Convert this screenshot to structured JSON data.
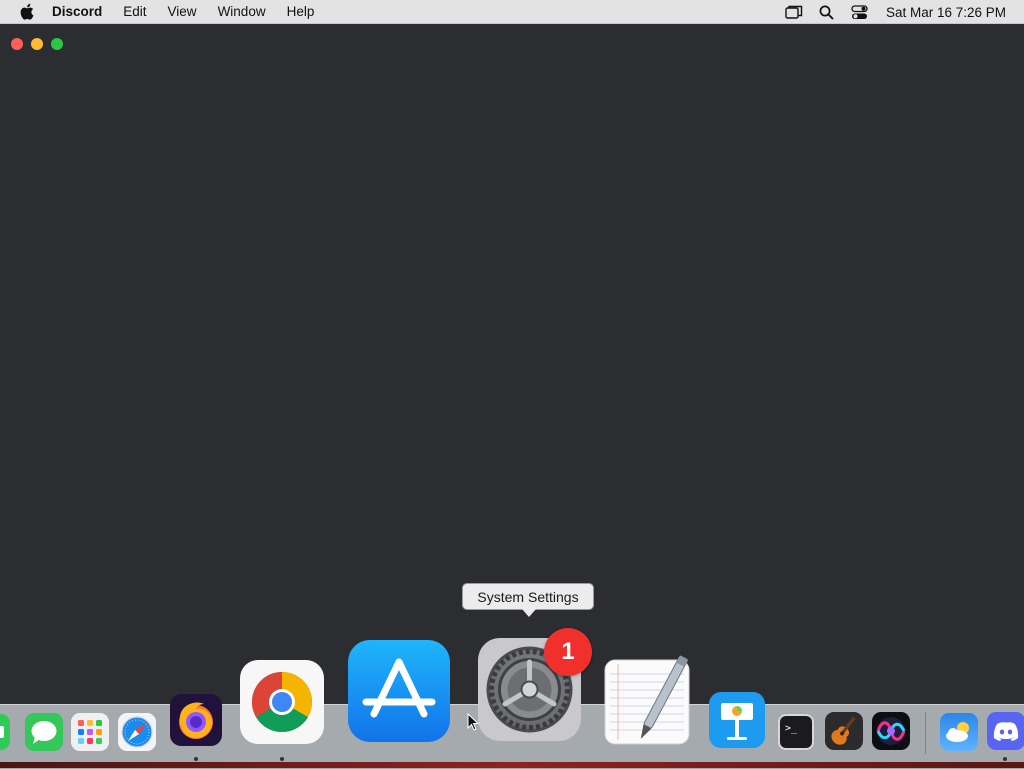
{
  "menubar": {
    "app_name": "Discord",
    "items": [
      "Edit",
      "View",
      "Window",
      "Help"
    ],
    "icons": [
      "apple-icon",
      "window-icon",
      "search-icon",
      "control-center-icon"
    ],
    "clock": "Sat Mar 16  7:26 PM"
  },
  "window": {
    "app": "Discord",
    "background": "#2b2d31"
  },
  "dock": {
    "tooltip": "System Settings",
    "badge_count": "1",
    "apps": [
      "FaceTime",
      "Messages",
      "Launchpad",
      "Safari",
      "Firefox",
      "Google Chrome",
      "App Store",
      "System Settings",
      "TextEdit",
      "Keynote",
      "Terminal",
      "GarageBand",
      "Siri",
      "Weather",
      "Discord"
    ],
    "running": [
      "Firefox",
      "Google Chrome",
      "Discord"
    ]
  },
  "colors": {
    "close": "#fe5f57",
    "minimize": "#febc2e",
    "maximize": "#28c840",
    "badge": "#f1302b"
  }
}
